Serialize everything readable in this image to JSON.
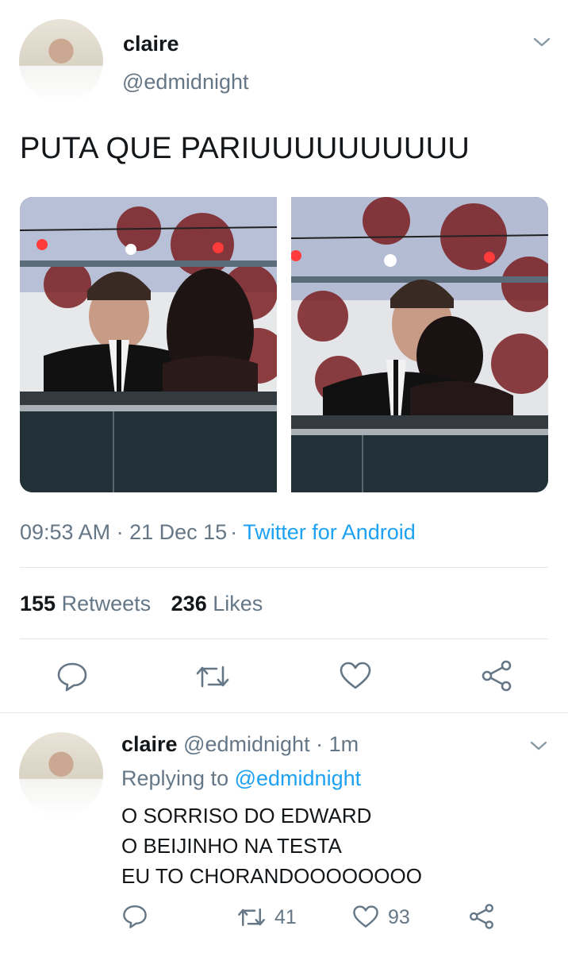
{
  "main_tweet": {
    "name": "claire",
    "handle": "@edmidnight",
    "text": "PUTA QUE PARIUUUUUUUUUU",
    "time": "09:53 AM",
    "date": "21 Dec 15",
    "source": "Twitter for Android",
    "retweets_count": "155",
    "retweets_label": "Retweets",
    "likes_count": "236",
    "likes_label": "Likes"
  },
  "reply": {
    "name": "claire",
    "handle": "@edmidnight",
    "time": "1m",
    "replying_prefix": "Replying to",
    "replying_handle": "@edmidnight",
    "lines": [
      "O SORRISO DO EDWARD",
      "O BEIJINHO NA TESTA",
      "EU TO CHORANDOOOOOOOO"
    ],
    "retweet_count": "41",
    "like_count": "93"
  },
  "separators": {
    "dot": "·"
  },
  "icons": [
    "chevron-down-icon",
    "reply-icon",
    "retweet-icon",
    "heart-icon",
    "share-icon"
  ],
  "colors": {
    "text": "#14171a",
    "muted": "#657786",
    "link": "#1da1f2",
    "divider": "#e1e8ed"
  }
}
